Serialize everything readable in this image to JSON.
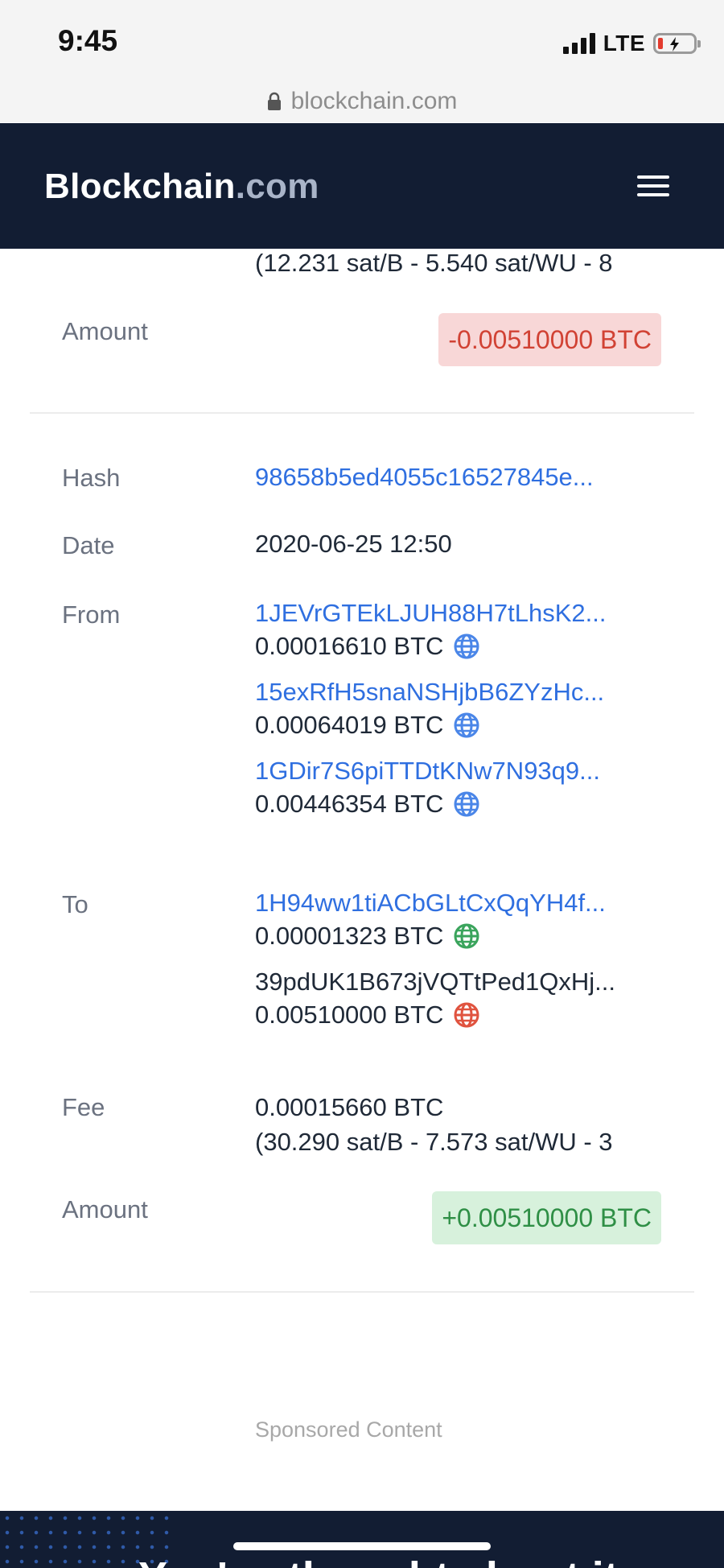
{
  "status_bar": {
    "time": "9:45",
    "network": "LTE"
  },
  "browser": {
    "url": "blockchain.com"
  },
  "header": {
    "logo_main": "Blockchain",
    "logo_suffix": ".com"
  },
  "tx1": {
    "fee_rate_text": "(12.231 sat/B - 5.540 sat/WU - 8",
    "amount_label": "Amount",
    "amount": "-0.00510000 BTC"
  },
  "tx2": {
    "hash_label": "Hash",
    "hash": "98658b5ed4055c16527845e...",
    "date_label": "Date",
    "date": "2020-06-25 12:50",
    "from_label": "From",
    "inputs": [
      {
        "address": "1JEVrGTEkLJUH88H7tLhsK2...",
        "amount": "0.00016610 BTC"
      },
      {
        "address": "15exRfH5snaNSHjbB6ZYzHc...",
        "amount": "0.00064019 BTC"
      },
      {
        "address": "1GDir7S6piTTDtKNw7N93q9...",
        "amount": "0.00446354 BTC"
      }
    ],
    "to_label": "To",
    "outputs": [
      {
        "address": "1H94ww1tiACbGLtCxQqYH4f...",
        "amount": "0.00001323 BTC",
        "globe_color": "#3aa45c"
      },
      {
        "address": "39pdUK1B673jVQTtPed1QxHj...",
        "amount": "0.00510000 BTC",
        "globe_color": "#e0533f"
      }
    ],
    "fee_label": "Fee",
    "fee": "0.00015660 BTC",
    "fee_rate_text": "(30.290 sat/B - 7.573 sat/WU - 3",
    "amount_label": "Amount",
    "amount": "+0.00510000 BTC"
  },
  "sponsored": {
    "label": "Sponsored Content"
  },
  "ad": {
    "headline": "You've thought about it"
  },
  "colors": {
    "link": "#2f6fe0",
    "header_bg": "#121d33",
    "negative": "#d14234",
    "positive": "#2f8f46",
    "input_globe": "#4a86e8"
  }
}
